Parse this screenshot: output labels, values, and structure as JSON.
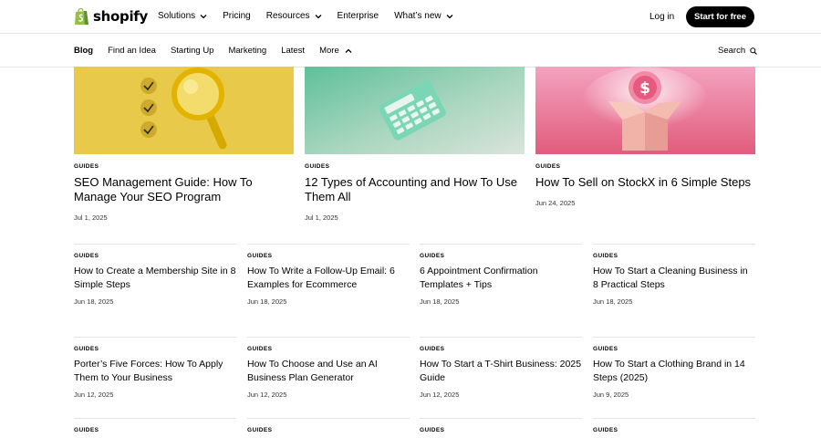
{
  "nav": {
    "brand": "shopify",
    "menu": [
      {
        "label": "Solutions",
        "dropdown": true
      },
      {
        "label": "Pricing",
        "dropdown": false
      },
      {
        "label": "Resources",
        "dropdown": true
      },
      {
        "label": "Enterprise",
        "dropdown": false
      },
      {
        "label": "What’s new",
        "dropdown": true
      }
    ],
    "login": "Log in",
    "cta": "Start for free",
    "brand_color": "#95BF47"
  },
  "subnav": {
    "items": [
      "Blog",
      "Find an Idea",
      "Starting Up",
      "Marketing",
      "Latest"
    ],
    "more": "More",
    "search": "Search"
  },
  "featured": [
    {
      "category": "GUIDES",
      "title": "SEO Management Guide: How To Manage Your SEO Program",
      "date": "Jul 1, 2025"
    },
    {
      "category": "GUIDES",
      "title": "12 Types of Accounting and How To Use Them All",
      "date": "Jul 1, 2025"
    },
    {
      "category": "GUIDES",
      "title": "How To Sell on StockX in 6 Simple Steps",
      "date": "Jun 24, 2025"
    }
  ],
  "grid": [
    {
      "category": "GUIDES",
      "title": "How to Create a Membership Site in 8 Simple Steps",
      "date": "Jun 18, 2025"
    },
    {
      "category": "GUIDES",
      "title": "How To Write a Follow-Up Email: 6 Examples for Ecommerce",
      "date": "Jun 18, 2025"
    },
    {
      "category": "GUIDES",
      "title": "6 Appointment Confirmation Templates + Tips",
      "date": "Jun 18, 2025"
    },
    {
      "category": "GUIDES",
      "title": "How To Start a Cleaning Business in 8 Practical Steps",
      "date": "Jun 18, 2025"
    },
    {
      "category": "GUIDES",
      "title": "Porter’s Five Forces: How To Apply Them to Your Business",
      "date": "Jun 12, 2025"
    },
    {
      "category": "GUIDES",
      "title": "How To Choose and Use an AI Business Plan Generator",
      "date": "Jun 12, 2025"
    },
    {
      "category": "GUIDES",
      "title": "How To Start a T-Shirt Business: 2025 Guide",
      "date": "Jun 12, 2025"
    },
    {
      "category": "GUIDES",
      "title": "How To Start a Clothing Brand in 14 Steps (2025)",
      "date": "Jun 9, 2025"
    },
    {
      "category": "GUIDES",
      "title": "",
      "date": ""
    },
    {
      "category": "GUIDES",
      "title": "",
      "date": ""
    },
    {
      "category": "GUIDES",
      "title": "",
      "date": ""
    },
    {
      "category": "GUIDES",
      "title": "",
      "date": ""
    }
  ]
}
